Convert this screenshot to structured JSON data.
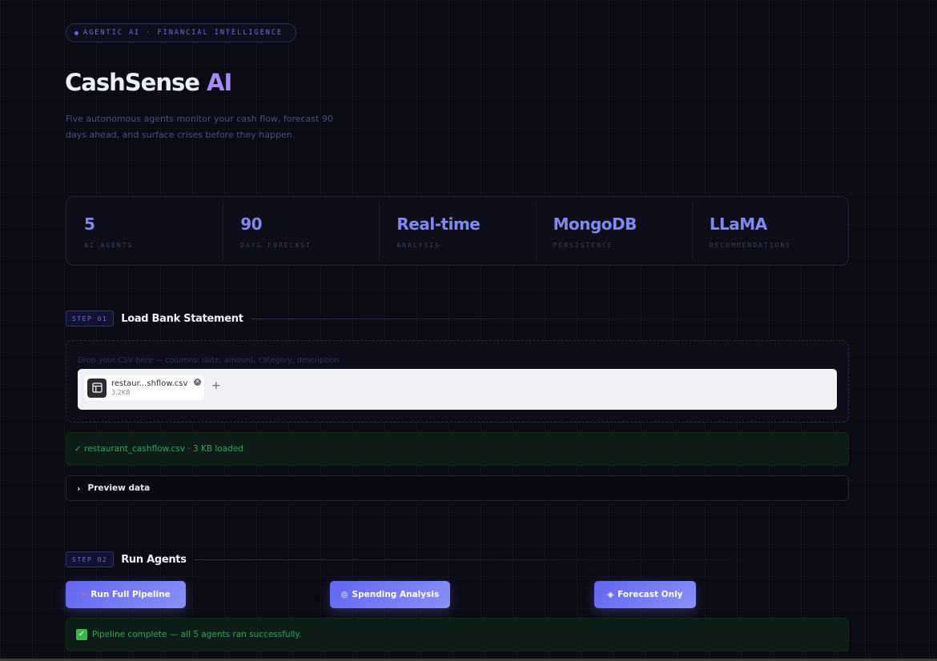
{
  "hero": {
    "badge": "AGENTIC AI · FINANCIAL INTELLIGENCE",
    "title_main": "CashSense",
    "title_accent": "AI",
    "subtitle": "Five autonomous agents monitor your cash flow, forecast 90 days ahead, and surface crises before they happen."
  },
  "stats": [
    {
      "value": "5",
      "label": "AI AGENTS"
    },
    {
      "value": "90",
      "label": "DAYS FORECAST"
    },
    {
      "value": "Real-time",
      "label": "ANALYSIS"
    },
    {
      "value": "MongoDB",
      "label": "PERSISTENCE"
    },
    {
      "value": "LLaMA",
      "label": "RECOMMENDATIONS"
    }
  ],
  "step1": {
    "pill": "STEP 01",
    "title": "Load Bank Statement",
    "dropzone_hint": "Drop your CSV here — columns: date, amount, category, description",
    "file": {
      "name": "restaur...shflow.csv",
      "size": "3.2KB"
    },
    "add_label": "+",
    "success": "✓ restaurant_cashflow.csv · 3 KB loaded",
    "preview_label": "Preview data"
  },
  "step2": {
    "pill": "STEP 02",
    "title": "Run Agents",
    "buttons": [
      {
        "icon": "⚡",
        "label": "Run Full Pipeline"
      },
      {
        "icon": "◎",
        "label": "Spending Analysis"
      },
      {
        "icon": "◈",
        "label": "Forecast Only"
      }
    ],
    "complete": "Pipeline complete — all 5 agents ran successfully."
  },
  "icons": {
    "badge": "dot-icon",
    "file": "table-file-icon",
    "remove": "close-icon",
    "expander": "chevron-right-icon",
    "complete": "check-box-icon"
  },
  "colors": {
    "accent": "#6366f1",
    "accent_light": "#a78bfa",
    "success": "#2fa560",
    "background": "#0b0b14"
  }
}
